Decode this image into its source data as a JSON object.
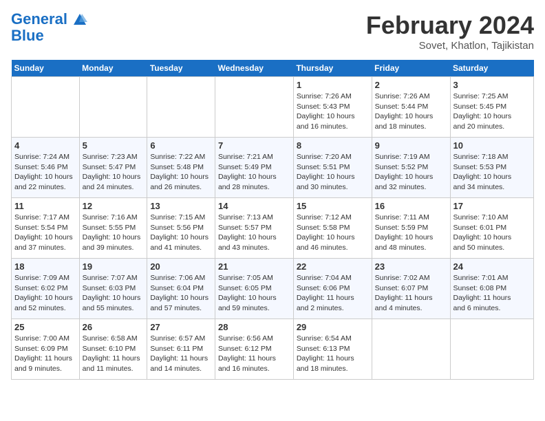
{
  "header": {
    "logo_line1": "General",
    "logo_line2": "Blue",
    "month_title": "February 2024",
    "subtitle": "Sovet, Khatlon, Tajikistan"
  },
  "weekdays": [
    "Sunday",
    "Monday",
    "Tuesday",
    "Wednesday",
    "Thursday",
    "Friday",
    "Saturday"
  ],
  "weeks": [
    [
      {
        "day": "",
        "info": ""
      },
      {
        "day": "",
        "info": ""
      },
      {
        "day": "",
        "info": ""
      },
      {
        "day": "",
        "info": ""
      },
      {
        "day": "1",
        "info": "Sunrise: 7:26 AM\nSunset: 5:43 PM\nDaylight: 10 hours\nand 16 minutes."
      },
      {
        "day": "2",
        "info": "Sunrise: 7:26 AM\nSunset: 5:44 PM\nDaylight: 10 hours\nand 18 minutes."
      },
      {
        "day": "3",
        "info": "Sunrise: 7:25 AM\nSunset: 5:45 PM\nDaylight: 10 hours\nand 20 minutes."
      }
    ],
    [
      {
        "day": "4",
        "info": "Sunrise: 7:24 AM\nSunset: 5:46 PM\nDaylight: 10 hours\nand 22 minutes."
      },
      {
        "day": "5",
        "info": "Sunrise: 7:23 AM\nSunset: 5:47 PM\nDaylight: 10 hours\nand 24 minutes."
      },
      {
        "day": "6",
        "info": "Sunrise: 7:22 AM\nSunset: 5:48 PM\nDaylight: 10 hours\nand 26 minutes."
      },
      {
        "day": "7",
        "info": "Sunrise: 7:21 AM\nSunset: 5:49 PM\nDaylight: 10 hours\nand 28 minutes."
      },
      {
        "day": "8",
        "info": "Sunrise: 7:20 AM\nSunset: 5:51 PM\nDaylight: 10 hours\nand 30 minutes."
      },
      {
        "day": "9",
        "info": "Sunrise: 7:19 AM\nSunset: 5:52 PM\nDaylight: 10 hours\nand 32 minutes."
      },
      {
        "day": "10",
        "info": "Sunrise: 7:18 AM\nSunset: 5:53 PM\nDaylight: 10 hours\nand 34 minutes."
      }
    ],
    [
      {
        "day": "11",
        "info": "Sunrise: 7:17 AM\nSunset: 5:54 PM\nDaylight: 10 hours\nand 37 minutes."
      },
      {
        "day": "12",
        "info": "Sunrise: 7:16 AM\nSunset: 5:55 PM\nDaylight: 10 hours\nand 39 minutes."
      },
      {
        "day": "13",
        "info": "Sunrise: 7:15 AM\nSunset: 5:56 PM\nDaylight: 10 hours\nand 41 minutes."
      },
      {
        "day": "14",
        "info": "Sunrise: 7:13 AM\nSunset: 5:57 PM\nDaylight: 10 hours\nand 43 minutes."
      },
      {
        "day": "15",
        "info": "Sunrise: 7:12 AM\nSunset: 5:58 PM\nDaylight: 10 hours\nand 46 minutes."
      },
      {
        "day": "16",
        "info": "Sunrise: 7:11 AM\nSunset: 5:59 PM\nDaylight: 10 hours\nand 48 minutes."
      },
      {
        "day": "17",
        "info": "Sunrise: 7:10 AM\nSunset: 6:01 PM\nDaylight: 10 hours\nand 50 minutes."
      }
    ],
    [
      {
        "day": "18",
        "info": "Sunrise: 7:09 AM\nSunset: 6:02 PM\nDaylight: 10 hours\nand 52 minutes."
      },
      {
        "day": "19",
        "info": "Sunrise: 7:07 AM\nSunset: 6:03 PM\nDaylight: 10 hours\nand 55 minutes."
      },
      {
        "day": "20",
        "info": "Sunrise: 7:06 AM\nSunset: 6:04 PM\nDaylight: 10 hours\nand 57 minutes."
      },
      {
        "day": "21",
        "info": "Sunrise: 7:05 AM\nSunset: 6:05 PM\nDaylight: 10 hours\nand 59 minutes."
      },
      {
        "day": "22",
        "info": "Sunrise: 7:04 AM\nSunset: 6:06 PM\nDaylight: 11 hours\nand 2 minutes."
      },
      {
        "day": "23",
        "info": "Sunrise: 7:02 AM\nSunset: 6:07 PM\nDaylight: 11 hours\nand 4 minutes."
      },
      {
        "day": "24",
        "info": "Sunrise: 7:01 AM\nSunset: 6:08 PM\nDaylight: 11 hours\nand 6 minutes."
      }
    ],
    [
      {
        "day": "25",
        "info": "Sunrise: 7:00 AM\nSunset: 6:09 PM\nDaylight: 11 hours\nand 9 minutes."
      },
      {
        "day": "26",
        "info": "Sunrise: 6:58 AM\nSunset: 6:10 PM\nDaylight: 11 hours\nand 11 minutes."
      },
      {
        "day": "27",
        "info": "Sunrise: 6:57 AM\nSunset: 6:11 PM\nDaylight: 11 hours\nand 14 minutes."
      },
      {
        "day": "28",
        "info": "Sunrise: 6:56 AM\nSunset: 6:12 PM\nDaylight: 11 hours\nand 16 minutes."
      },
      {
        "day": "29",
        "info": "Sunrise: 6:54 AM\nSunset: 6:13 PM\nDaylight: 11 hours\nand 18 minutes."
      },
      {
        "day": "",
        "info": ""
      },
      {
        "day": "",
        "info": ""
      }
    ]
  ]
}
